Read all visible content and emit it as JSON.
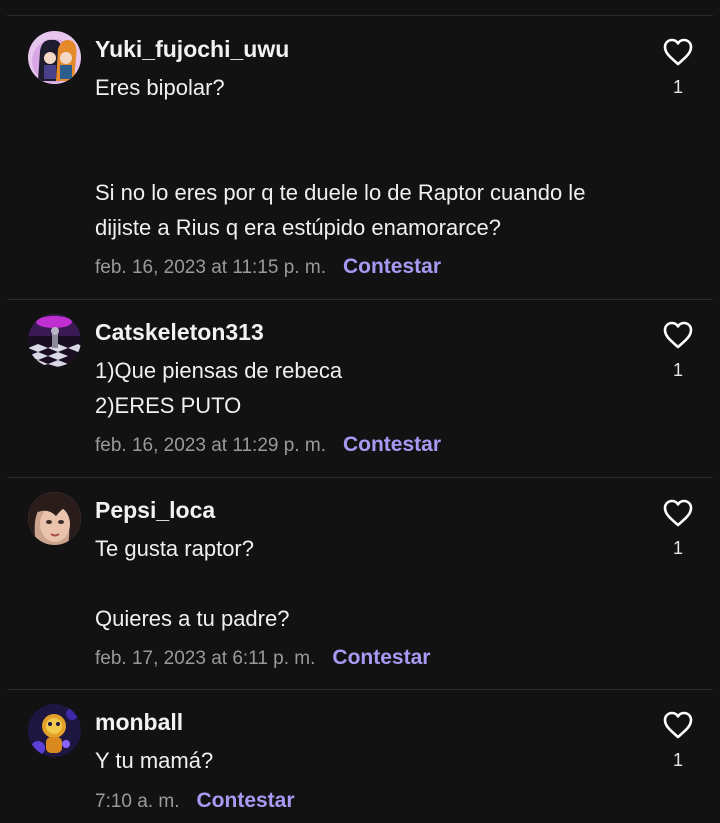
{
  "comments": [
    {
      "username": "Yuki_fujochi_uwu",
      "lines": [
        "Eres bipolar?",
        "",
        "",
        "Si no lo eres por q te duele lo de Raptor cuando le",
        "dijiste a Rius q era estúpido enamorarce?"
      ],
      "timestamp": "feb. 16, 2023 at 11:15 p. m.",
      "reply_label": "Contestar",
      "likes": "1"
    },
    {
      "username": "Catskeleton313",
      "lines": [
        "1)Que piensas de rebeca",
        "2)ERES PUTO"
      ],
      "timestamp": "feb. 16, 2023 at 11:29 p. m.",
      "reply_label": "Contestar",
      "likes": "1"
    },
    {
      "username": "Pepsi_loca",
      "lines": [
        "Te gusta raptor?",
        "",
        "Quieres a tu padre?"
      ],
      "timestamp": "feb. 17, 2023 at 6:11 p. m.",
      "reply_label": "Contestar",
      "likes": "1"
    },
    {
      "username": "monball",
      "lines": [
        "Y tu mamá?"
      ],
      "timestamp": "7:10 a. m.",
      "reply_label": "Contestar",
      "likes": "1"
    }
  ],
  "icons": {
    "like": "heart-outline-icon"
  },
  "colors": {
    "background": "#121212",
    "accent": "#a89af3",
    "timestamp": "#9a9a9a",
    "divider": "#2b2b2b"
  }
}
